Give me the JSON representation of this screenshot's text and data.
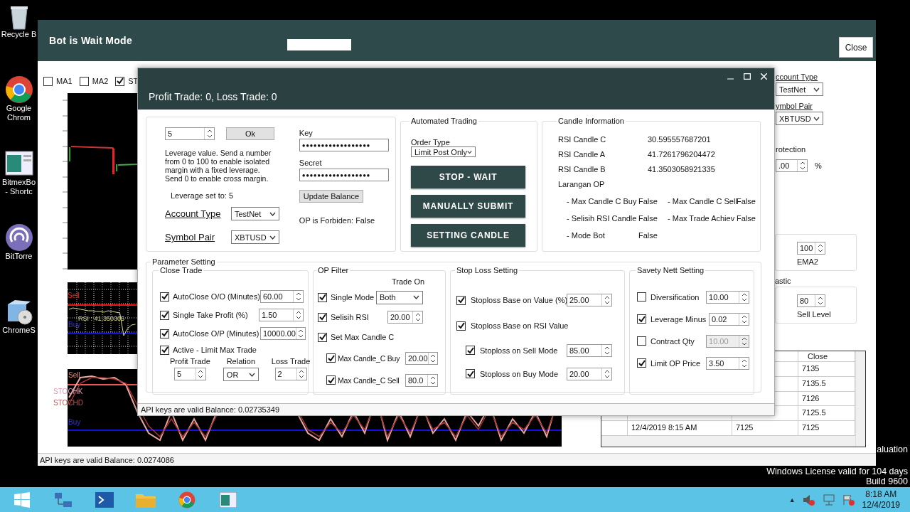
{
  "desktop_icons": [
    {
      "label": "Recycle B",
      "kind": "bin"
    },
    {
      "label": "Google Chrom",
      "kind": "browser"
    },
    {
      "label": "BitmexBo - Shortc",
      "kind": "app"
    },
    {
      "label": "BitTorre",
      "kind": "torrent"
    },
    {
      "label": "ChromeS",
      "kind": "setup"
    }
  ],
  "main_window": {
    "title": "Bot is Wait Mode",
    "close_button": "Close",
    "indicators": [
      {
        "label": "MA1",
        "checked": false
      },
      {
        "label": "MA2",
        "checked": false
      },
      {
        "label": "ST",
        "checked": true
      }
    ],
    "charts": [
      {
        "kind": "price"
      },
      {
        "kind": "rsi",
        "labels": [
          "Sell",
          "Buy",
          "RSI : 41.350305"
        ]
      },
      {
        "kind": "stochastic",
        "labels": [
          "Sell",
          "STOCHK",
          "STOCHD",
          "Buy"
        ]
      }
    ],
    "side_panel": {
      "account_type_label": "ccount Type",
      "account_type": "TestNet",
      "symbol_pair_label": "ymbol Pair",
      "symbol_pair": "XBTUSD",
      "protection_title": "rotection",
      "protection_value": ".00",
      "protection_unit": "%",
      "ema_value": "100",
      "ema_label": "EMA2",
      "stochastic_title": "astic",
      "sell_value": "80",
      "sell_label": "Sell Level"
    },
    "table": {
      "header": "Close",
      "rows": [
        {
          "close": "7135"
        },
        {
          "close": "7135.5"
        },
        {
          "close": "7126"
        },
        {
          "close": "7125.5"
        },
        {
          "column_1": "12/4/2019 8:15 AM",
          "column_2": "7125",
          "close": "7125"
        }
      ]
    },
    "status": "API keys are valid  Balance: 0.0274086"
  },
  "dialog": {
    "header": "Profit Trade: 0, Loss Trade: 0",
    "leverage": {
      "value": "5",
      "ok": "Ok",
      "help": "Leverage value. Send a number from 0 to 100 to enable isolated margin with a fixed leverage. Send 0 to enable cross margin.",
      "status": "Leverage set to: 5"
    },
    "account_type": {
      "label": "Account Type",
      "value": "TestNet"
    },
    "symbol_pair": {
      "label": "Symbol Pair",
      "value": "XBTUSD"
    },
    "key": {
      "label": "Key",
      "value": "●●●●●●●●●●●●●●●●●●"
    },
    "secret": {
      "label": "Secret",
      "value": "●●●●●●●●●●●●●●●●●●"
    },
    "update_balance": "Update Balance",
    "op_forbidden": "OP is Forbiden: False",
    "automated_trading": {
      "title": "Automated Trading",
      "order_type_label": "Order Type",
      "order_type": "Limit Post Only",
      "buttons": [
        "STOP - WAIT",
        "MANUALLY SUBMIT",
        "SETTING CANDLE"
      ]
    },
    "candle_information": {
      "title": "Candle Information",
      "values": [
        {
          "label": "RSI Candle C",
          "value": "30.595557687201"
        },
        {
          "label": "RSI Candle A",
          "value": "41.7261796204472"
        },
        {
          "label": "RSI Candle B",
          "value": "41.3503058921335"
        }
      ],
      "larangan_title": "Larangan OP",
      "flags": [
        {
          "label": "- Max Candle C Buy",
          "value": "False"
        },
        {
          "label": "- Max Candle C Sell",
          "value": "False"
        },
        {
          "label": "- Selisih RSI Candle",
          "value": "False"
        },
        {
          "label": "- Max Trade Achiev",
          "value": "False"
        },
        {
          "label": "- Mode Bot",
          "value": "False"
        }
      ]
    },
    "parameter_setting": {
      "title": "Parameter Setting",
      "close_trade": {
        "title": "Close Trade",
        "rows": [
          {
            "label": "AutoClose O/O (Minutes)",
            "checked": true,
            "value": "60.00"
          },
          {
            "label": "Single Take Profit (%)",
            "checked": true,
            "value": "1.50"
          },
          {
            "label": "AutoClose O/P (Minutes)",
            "checked": true,
            "value": "10000.00"
          }
        ],
        "limit": {
          "label": "Active - Limit Max Trade",
          "checked": true
        },
        "profit_trade": {
          "label": "Profit Trade",
          "value": "5"
        },
        "relation": {
          "label": "Relation",
          "value": "OR"
        },
        "loss_trade": {
          "label": "Loss Trade",
          "value": "2"
        }
      },
      "op_filter": {
        "title": "OP Filter",
        "trade_on_label": "Trade On",
        "trade_on": "Both",
        "rows": [
          {
            "label": "Single Mode",
            "checked": true
          },
          {
            "label": "Selisih RSI",
            "checked": true,
            "value": "20.00"
          },
          {
            "label": "Set Max Candle C",
            "checked": true,
            "children": [
              {
                "label": "Max Candle_C Buy",
                "checked": true,
                "value": "20.00"
              },
              {
                "label": "Max Candle_C Sell",
                "checked": true,
                "value": "80.0"
              }
            ]
          }
        ]
      },
      "stop_loss": {
        "title": "Stop Loss Setting",
        "rows": [
          {
            "label": "Stoploss Base on Value (%)",
            "checked": true,
            "value": "25.00"
          },
          {
            "label": "Stoploss Base on RSI Value",
            "checked": true,
            "children": [
              {
                "label": "Stoploss on Sell Mode",
                "checked": true,
                "value": "85.00"
              },
              {
                "label": "Stoploss on Buy Mode",
                "checked": true,
                "value": "20.00"
              }
            ]
          }
        ]
      },
      "safety_net": {
        "title": "Savety Nett Setting",
        "rows": [
          {
            "label": "Diversification",
            "checked": false,
            "value": "10.00",
            "disabled": false
          },
          {
            "label": "Leverage Minus",
            "checked": true,
            "value": "0.02",
            "disabled": false
          },
          {
            "label": "Contract Qty",
            "checked": false,
            "value": "10.00",
            "disabled": true
          },
          {
            "label": "Limit OP Price",
            "checked": true,
            "value": "3.50",
            "disabled": false
          }
        ]
      }
    },
    "status": "API keys are valid  Balance: 0.02735349"
  },
  "os_notice": [
    "aluation",
    "Windows License valid for 104 days",
    "Build 9600"
  ],
  "taskbar": {
    "tray_arrow": "▲",
    "time": "8:18 AM",
    "date": "12/4/2019"
  }
}
